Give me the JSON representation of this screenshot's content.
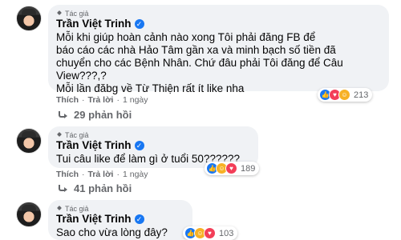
{
  "comments": [
    {
      "badge": "Tác giả",
      "author": "Trần Việt Trinh",
      "text_lines": [
        "Mỗi khi giúp hoàn cảnh nào xong Tôi phải đăng FB để",
        "báo cáo các nhà Hảo Tâm gần xa và minh bạch số tiền đã",
        "chuyển cho các Bệnh Nhân. Chứ đâu phải Tôi đăng để Câu",
        "View???,?",
        "Mỗi lần đăbg về Từ Thiện rất ít like nha"
      ],
      "reaction_count": "213",
      "action_like": "Thích",
      "action_reply": "Trả lời",
      "time": "1 ngày",
      "replies": "29 phản hồi"
    },
    {
      "badge": "Tác giả",
      "author": "Trần Việt Trinh",
      "text_lines": [
        "Tui câu like để làm gì ở tuổi 50??????"
      ],
      "reaction_count": "189",
      "action_like": "Thích",
      "action_reply": "Trả lời",
      "time": "1 ngày",
      "replies": "41 phản hồi"
    },
    {
      "badge": "Tác giả",
      "author": "Trần Việt Trinh",
      "text_lines": [
        "Sao cho vừa lòng đây?"
      ],
      "reaction_count": "103"
    }
  ],
  "separator": "·",
  "icons": {
    "badge": "author-badge-icon",
    "verified": "verified-check-icon",
    "like": "like-reaction-icon",
    "love": "love-reaction-icon",
    "haha": "haha-reaction-icon",
    "reply": "reply-arrow-icon"
  },
  "colors": {
    "bubble": "#f0f2f5",
    "verified": "#1877f2",
    "muted_text": "#65676b"
  }
}
